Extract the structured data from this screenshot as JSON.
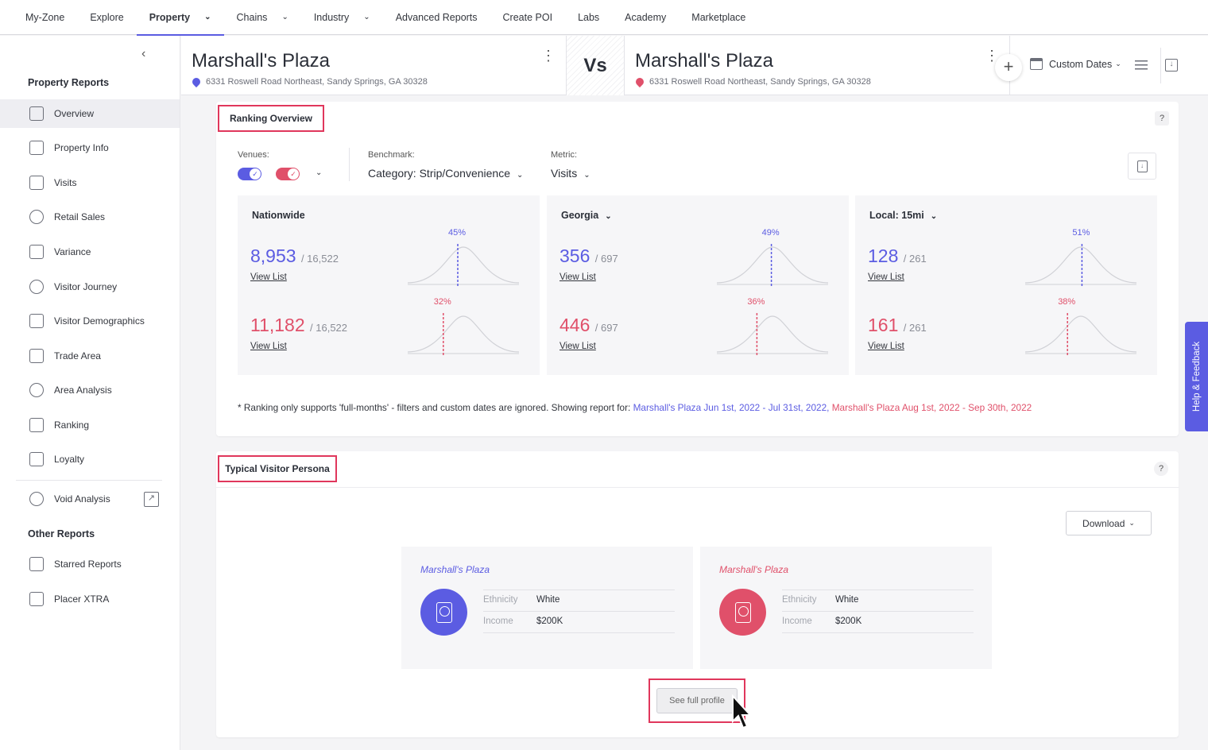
{
  "topnav": {
    "items": [
      {
        "label": "My-Zone",
        "dropdown": false
      },
      {
        "label": "Explore",
        "dropdown": false
      },
      {
        "label": "Property",
        "dropdown": true,
        "active": true
      },
      {
        "label": "Chains",
        "dropdown": true
      },
      {
        "label": "Industry",
        "dropdown": true
      },
      {
        "label": "Advanced Reports",
        "dropdown": false
      },
      {
        "label": "Create POI",
        "dropdown": false
      },
      {
        "label": "Labs",
        "dropdown": false
      },
      {
        "label": "Academy",
        "dropdown": false
      },
      {
        "label": "Marketplace",
        "dropdown": false
      }
    ]
  },
  "sidebar": {
    "property_reports_heading": "Property Reports",
    "items": [
      {
        "label": "Overview",
        "icon": "bar-chart-icon",
        "active": true
      },
      {
        "label": "Property Info",
        "icon": "building-icon"
      },
      {
        "label": "Visits",
        "icon": "visits-icon"
      },
      {
        "label": "Retail Sales",
        "icon": "target-icon"
      },
      {
        "label": "Variance",
        "icon": "variance-chart-icon"
      },
      {
        "label": "Visitor Journey",
        "icon": "journey-icon"
      },
      {
        "label": "Visitor Demographics",
        "icon": "demographics-icon"
      },
      {
        "label": "Trade Area",
        "icon": "trade-area-icon"
      },
      {
        "label": "Area Analysis",
        "icon": "area-analysis-icon"
      },
      {
        "label": "Ranking",
        "icon": "ranking-icon"
      },
      {
        "label": "Loyalty",
        "icon": "heart-icon"
      }
    ],
    "void_analysis": "Void Analysis",
    "other_reports_heading": "Other Reports",
    "other_items": [
      {
        "label": "Starred Reports",
        "icon": "star-icon"
      },
      {
        "label": "Placer XTRA",
        "icon": "placer-xtra-icon"
      }
    ]
  },
  "header": {
    "venue_a": {
      "name": "Marshall's Plaza",
      "address": "6331 Roswell Road Northeast, Sandy Springs, GA 30328"
    },
    "vs_label": "Vs",
    "venue_b": {
      "name": "Marshall's Plaza",
      "address": "6331 Roswell Road Northeast, Sandy Springs, GA 30328"
    },
    "date_label": "Custom Dates"
  },
  "colors": {
    "blue": "#5b5ce2",
    "red": "#e0506a",
    "highlight": "#e0375c"
  },
  "ranking": {
    "title": "Ranking Overview",
    "venues_label": "Venues:",
    "benchmark_label": "Benchmark:",
    "benchmark_value": "Category: Strip/Convenience",
    "metric_label": "Metric:",
    "metric_value": "Visits",
    "panels": [
      {
        "title": "Nationwide",
        "dropdown": false,
        "a": {
          "rank": "8,953",
          "total": "/ 16,522",
          "pct": "45%",
          "pct_value": 0.45,
          "link": "View List"
        },
        "b": {
          "rank": "11,182",
          "total": "/ 16,522",
          "pct": "32%",
          "pct_value": 0.32,
          "link": "View List"
        }
      },
      {
        "title": "Georgia",
        "dropdown": true,
        "a": {
          "rank": "356",
          "total": "/ 697",
          "pct": "49%",
          "pct_value": 0.49,
          "link": "View List"
        },
        "b": {
          "rank": "446",
          "total": "/ 697",
          "pct": "36%",
          "pct_value": 0.36,
          "link": "View List"
        }
      },
      {
        "title": "Local: 15mi",
        "dropdown": true,
        "a": {
          "rank": "128",
          "total": "/ 261",
          "pct": "51%",
          "pct_value": 0.51,
          "link": "View List"
        },
        "b": {
          "rank": "161",
          "total": "/ 261",
          "pct": "38%",
          "pct_value": 0.38,
          "link": "View List"
        }
      }
    ],
    "footnote": {
      "prefix": "* Ranking only supports 'full-months' - filters and custom dates are ignored. Showing report for: ",
      "blue": "Marshall's Plaza Jun 1st, 2022 - Jul 31st, 2022,",
      "red": "Marshall's Plaza Aug 1st, 2022 - Sep 30th, 2022"
    }
  },
  "persona": {
    "title": "Typical Visitor Persona",
    "download_label": "Download",
    "cards": [
      {
        "name": "Marshall's Plaza",
        "ethnicity_label": "Ethnicity",
        "ethnicity": "White",
        "income_label": "Income",
        "income": "$200K"
      },
      {
        "name": "Marshall's Plaza",
        "ethnicity_label": "Ethnicity",
        "ethnicity": "White",
        "income_label": "Income",
        "income": "$200K"
      }
    ],
    "full_profile_label": "See full profile"
  },
  "feedback_label": "Help & Feedback"
}
